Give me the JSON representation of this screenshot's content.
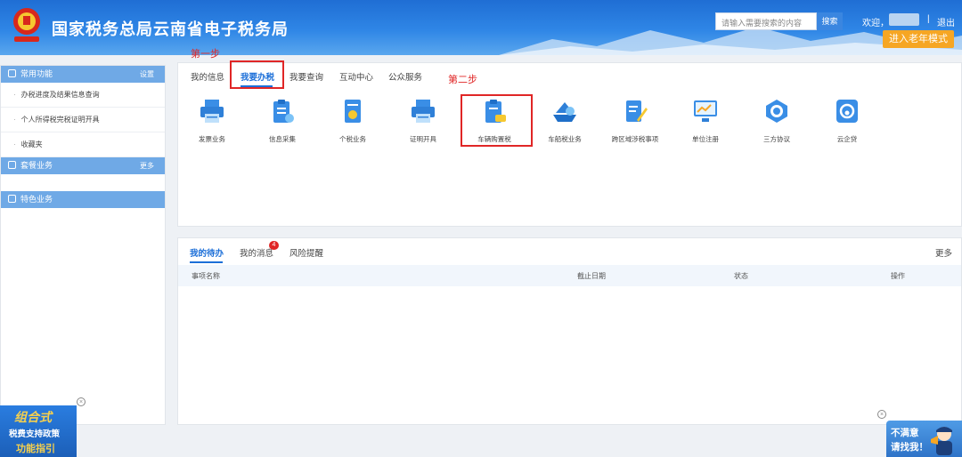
{
  "header": {
    "title": "国家税务总局云南省电子税务局",
    "search_placeholder": "请输入需要搜索的内容",
    "search_button": "搜索",
    "welcome": "欢迎，",
    "separator": "|",
    "logout": "退出",
    "elder_mode": "进入老年模式"
  },
  "sidebar": {
    "common_title": "常用功能",
    "common_settings": "设置",
    "common_items": [
      "办税进度及结果信息查询",
      "个人所得税完税证明开具",
      "收藏夹"
    ],
    "package_title": "套餐业务",
    "package_more": "更多",
    "special_title": "特色业务"
  },
  "tabs": [
    "我的信息",
    "我要办税",
    "我要查询",
    "互动中心",
    "公众服务"
  ],
  "annotations": {
    "step1": "第一步",
    "step2": "第二步"
  },
  "services": [
    {
      "label": "发票业务",
      "icon": "printer-icon"
    },
    {
      "label": "信息采集",
      "icon": "clipboard-icon"
    },
    {
      "label": "个税业务",
      "icon": "document-icon"
    },
    {
      "label": "证明开具",
      "icon": "printer-icon"
    },
    {
      "label": "车辆购置税",
      "icon": "vehicle-clipboard-icon"
    },
    {
      "label": "车船税业务",
      "icon": "ship-icon"
    },
    {
      "label": "跨区域涉税事项",
      "icon": "edit-document-icon"
    },
    {
      "label": "单位注册",
      "icon": "monitor-chart-icon"
    },
    {
      "label": "三方协议",
      "icon": "agreement-icon"
    },
    {
      "label": "云企贷",
      "icon": "cloud-loan-icon"
    }
  ],
  "todo": {
    "tabs": [
      "我的待办",
      "我的消息",
      "风险提醒"
    ],
    "message_badge": "4",
    "more": "更多",
    "columns": [
      "事项名称",
      "截止日期",
      "状态",
      "操作"
    ]
  },
  "promo": {
    "line1": "组合式",
    "line2": "税费支持政策",
    "line3": "功能指引",
    "close": "×"
  },
  "complaint": {
    "line1": "不满意",
    "line2": "请找我！",
    "close": "×"
  },
  "colors": {
    "primary": "#1c6fd8",
    "sidebar_header": "#6fa9e6",
    "annotation": "#e02626",
    "elder_button": "#f6a623"
  }
}
